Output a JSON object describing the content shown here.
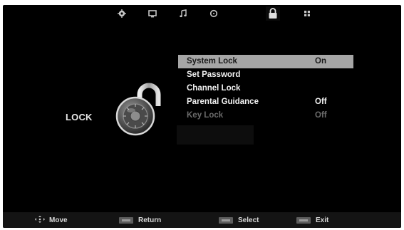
{
  "top_nav": {
    "icons": [
      {
        "name": "picture-icon"
      },
      {
        "name": "screen-icon"
      },
      {
        "name": "music-icon"
      },
      {
        "name": "clock-icon"
      },
      {
        "name": "lock-icon",
        "active": true
      },
      {
        "name": "setup-icon"
      }
    ]
  },
  "section": {
    "title": "LOCK"
  },
  "menu": {
    "items": [
      {
        "label": "System Lock",
        "value": "On",
        "state": "selected"
      },
      {
        "label": "Set Password",
        "value": ""
      },
      {
        "label": "Channel Lock",
        "value": ""
      },
      {
        "label": "Parental Guidance",
        "value": "Off"
      },
      {
        "label": "Key Lock",
        "value": "Off",
        "state": "disabled"
      }
    ]
  },
  "footer": {
    "move": "Move",
    "return": "Return",
    "select": "Select",
    "exit": "Exit"
  },
  "colors": {
    "background": "#000000",
    "highlight": "#a6a6a6",
    "text": "#f2f2f2",
    "disabled_text": "#6c6c6c"
  }
}
